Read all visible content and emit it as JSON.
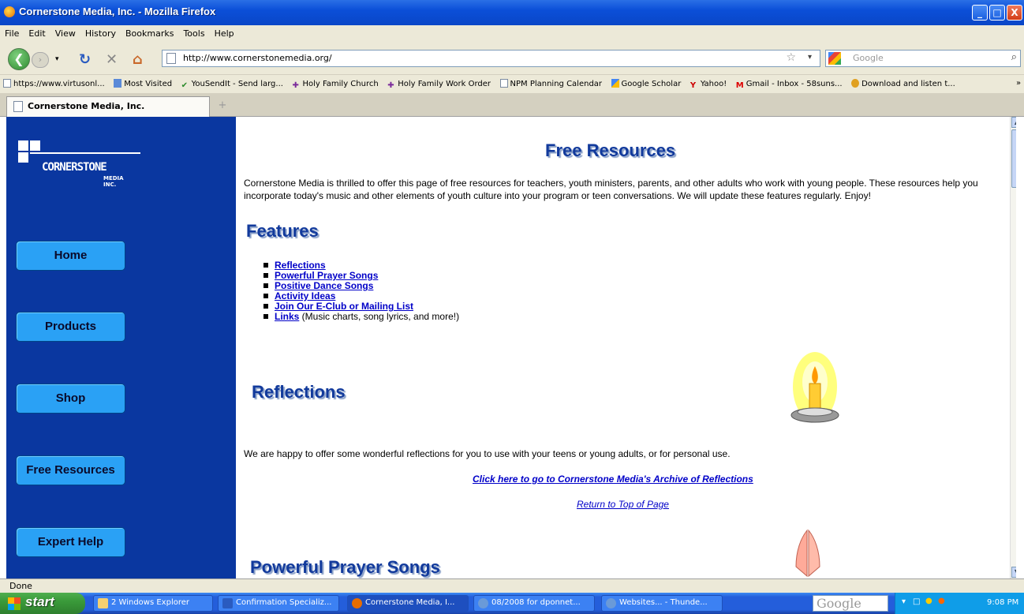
{
  "window": {
    "title": "Cornerstone Media, Inc. - Mozilla Firefox",
    "controls": [
      "_",
      "□",
      "X"
    ]
  },
  "menu": [
    "File",
    "Edit",
    "View",
    "History",
    "Bookmarks",
    "Tools",
    "Help"
  ],
  "navigation": {
    "url": "http://www.cornerstonemedia.org/",
    "search_placeholder": "Google"
  },
  "bookmarks": [
    "https://www.virtusonl...",
    "Most Visited",
    "YouSendIt - Send larg...",
    "Holy Family Church",
    "Holy Family Work Order",
    "NPM Planning Calendar",
    "Google Scholar",
    "Yahoo!",
    "Gmail - Inbox - 58suns...",
    "Download and listen t..."
  ],
  "tab": {
    "label": "Cornerstone Media, Inc.",
    "new_tab": "+"
  },
  "sidebar": {
    "logo_word": "CORNERSTONE",
    "logo_sub": "MEDIA INC.",
    "buttons": [
      "Home",
      "Products",
      "Shop",
      "Free Resources",
      "Expert Help"
    ]
  },
  "page": {
    "heading": "Free Resources",
    "intro": "Cornerstone Media is thrilled to offer this page of free resources for teachers, youth ministers, parents, and other adults who work with young people. These resources help you incorporate today's music and other elements of youth culture into your program or teen conversations. We will update these features regularly. Enjoy!",
    "features_heading": "Features",
    "features": [
      {
        "link": "Reflections",
        "note": ""
      },
      {
        "link": "Powerful Prayer Songs",
        "note": ""
      },
      {
        "link": "Positive Dance Songs",
        "note": ""
      },
      {
        "link": "Activity Ideas",
        "note": ""
      },
      {
        "link": "Join Our E-Club or Mailing List",
        "note": ""
      },
      {
        "link": "Links",
        "note": " (Music charts, song lyrics, and more!)"
      }
    ],
    "reflections_heading": "Reflections",
    "reflections_text": "We are happy to offer some wonderful reflections for you to use with your teens or young adults, or for personal use.",
    "archive_link": "Click here to go to Cornerstone Media's Archive of Reflections",
    "return_top": "Return to Top of Page",
    "prayer_heading": "Powerful Prayer Songs"
  },
  "status": "Done",
  "taskbar": {
    "start": "start",
    "items": [
      "2 Windows Explorer",
      "Confirmation Specializ...",
      "Cornerstone Media, I...",
      "08/2008 for dponnet...",
      "Websites... - Thunde..."
    ],
    "google": "Google",
    "clock": "9:08 PM"
  }
}
